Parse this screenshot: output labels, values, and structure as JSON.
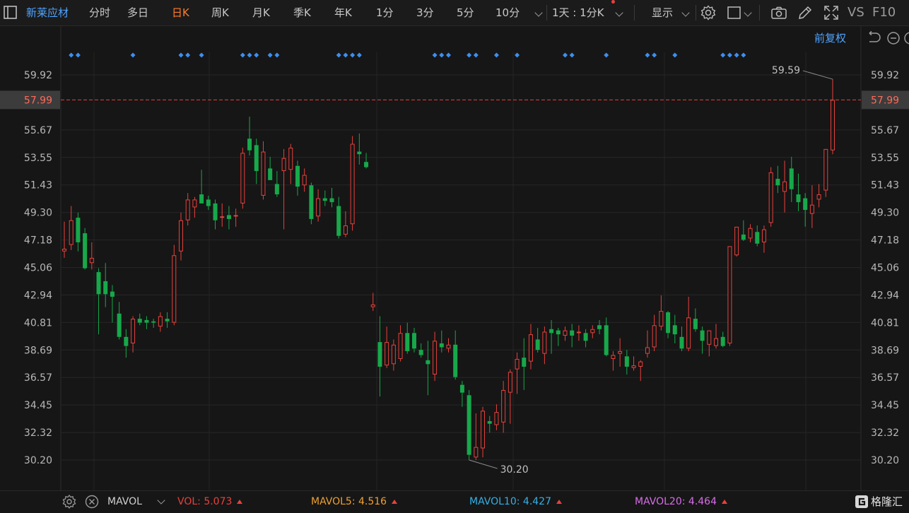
{
  "toolbar": {
    "stock_name": "新莱应材",
    "periods": [
      "分时",
      "多日",
      "日K",
      "周K",
      "月K",
      "季K",
      "年K",
      "1分",
      "3分",
      "5分",
      "10分"
    ],
    "active_period": "日K",
    "multi_period": "1天 : 1分K",
    "display_label": "显示",
    "vs_label": "VS",
    "f10_label": "F10"
  },
  "adjust_label": "前复权",
  "chart_data": {
    "type": "candlestick",
    "y_ticks": [
      "59.92",
      "57.99",
      "55.67",
      "53.55",
      "51.43",
      "49.30",
      "47.18",
      "45.06",
      "42.94",
      "40.81",
      "38.69",
      "36.57",
      "34.45",
      "32.32",
      "30.20"
    ],
    "ylim": [
      30.2,
      59.92
    ],
    "current_price": "57.99",
    "max_label": "59.59",
    "min_label": "30.20",
    "colors": {
      "up": "#e8413c",
      "down": "#17a84a",
      "price_line": "#e8413c",
      "marker": "#3d8ff0"
    },
    "event_markers": [
      1,
      2,
      10,
      17,
      18,
      20,
      26,
      27,
      28,
      30,
      31,
      40,
      41,
      42,
      43,
      54,
      55,
      56,
      59,
      60,
      63,
      66,
      73,
      74,
      79,
      85,
      86,
      89,
      96,
      97,
      98,
      99
    ],
    "candles": [
      {
        "o": 46.3,
        "h": 48.6,
        "l": 45.8,
        "c": 46.5
      },
      {
        "o": 46.8,
        "h": 49.8,
        "l": 46.4,
        "c": 48.7
      },
      {
        "o": 48.9,
        "h": 49.3,
        "l": 46.3,
        "c": 47.0
      },
      {
        "o": 47.7,
        "h": 48.1,
        "l": 44.9,
        "c": 45.0
      },
      {
        "o": 45.4,
        "h": 47.0,
        "l": 44.9,
        "c": 45.8
      },
      {
        "o": 44.7,
        "h": 45.0,
        "l": 39.9,
        "c": 43.0
      },
      {
        "o": 44.0,
        "h": 45.4,
        "l": 42.0,
        "c": 43.0
      },
      {
        "o": 43.2,
        "h": 43.7,
        "l": 40.8,
        "c": 42.8
      },
      {
        "o": 41.5,
        "h": 42.4,
        "l": 39.5,
        "c": 39.7
      },
      {
        "o": 39.7,
        "h": 40.3,
        "l": 38.1,
        "c": 39.0
      },
      {
        "o": 39.2,
        "h": 41.3,
        "l": 38.5,
        "c": 41.1
      },
      {
        "o": 41.1,
        "h": 41.5,
        "l": 40.6,
        "c": 40.8
      },
      {
        "o": 41.0,
        "h": 41.3,
        "l": 40.3,
        "c": 40.8
      },
      {
        "o": 40.9,
        "h": 41.1,
        "l": 40.4,
        "c": 40.8
      },
      {
        "o": 40.5,
        "h": 41.6,
        "l": 40.1,
        "c": 41.3
      },
      {
        "o": 41.1,
        "h": 41.6,
        "l": 40.4,
        "c": 40.9
      },
      {
        "o": 40.8,
        "h": 46.8,
        "l": 40.6,
        "c": 46.0
      },
      {
        "o": 46.3,
        "h": 49.3,
        "l": 45.6,
        "c": 48.7
      },
      {
        "o": 48.7,
        "h": 50.8,
        "l": 48.3,
        "c": 50.3
      },
      {
        "o": 49.7,
        "h": 50.5,
        "l": 48.9,
        "c": 50.3
      },
      {
        "o": 50.7,
        "h": 52.6,
        "l": 50.4,
        "c": 50.0
      },
      {
        "o": 50.3,
        "h": 50.6,
        "l": 49.5,
        "c": 49.8
      },
      {
        "o": 50.0,
        "h": 50.3,
        "l": 48.0,
        "c": 48.7
      },
      {
        "o": 49.0,
        "h": 50.0,
        "l": 48.2,
        "c": 49.0
      },
      {
        "o": 49.1,
        "h": 49.8,
        "l": 48.0,
        "c": 48.8
      },
      {
        "o": 49.1,
        "h": 49.6,
        "l": 48.2,
        "c": 49.1
      },
      {
        "o": 50.0,
        "h": 54.3,
        "l": 49.6,
        "c": 53.9
      },
      {
        "o": 55.0,
        "h": 56.7,
        "l": 53.7,
        "c": 54.1
      },
      {
        "o": 54.5,
        "h": 55.0,
        "l": 51.5,
        "c": 52.5
      },
      {
        "o": 50.6,
        "h": 54.8,
        "l": 50.3,
        "c": 54.0
      },
      {
        "o": 52.7,
        "h": 53.6,
        "l": 51.8,
        "c": 51.8
      },
      {
        "o": 51.5,
        "h": 52.5,
        "l": 50.5,
        "c": 50.7
      },
      {
        "o": 52.5,
        "h": 54.2,
        "l": 48.0,
        "c": 53.5
      },
      {
        "o": 52.6,
        "h": 54.6,
        "l": 51.5,
        "c": 54.3
      },
      {
        "o": 52.9,
        "h": 53.3,
        "l": 50.6,
        "c": 51.3
      },
      {
        "o": 51.4,
        "h": 52.7,
        "l": 50.9,
        "c": 52.2
      },
      {
        "o": 51.4,
        "h": 51.6,
        "l": 48.4,
        "c": 48.8
      },
      {
        "o": 49.0,
        "h": 51.1,
        "l": 48.6,
        "c": 50.4
      },
      {
        "o": 50.4,
        "h": 51.0,
        "l": 49.8,
        "c": 50.2
      },
      {
        "o": 50.4,
        "h": 51.2,
        "l": 49.7,
        "c": 50.1
      },
      {
        "o": 49.8,
        "h": 50.5,
        "l": 47.3,
        "c": 47.5
      },
      {
        "o": 47.6,
        "h": 49.4,
        "l": 47.4,
        "c": 48.3
      },
      {
        "o": 48.4,
        "h": 55.2,
        "l": 47.9,
        "c": 54.6
      },
      {
        "o": 54.0,
        "h": 55.4,
        "l": 53.0,
        "c": 53.8
      },
      {
        "o": 53.2,
        "h": 53.9,
        "l": 52.7,
        "c": 52.8
      },
      {
        "o": 42.0,
        "h": 43.1,
        "l": 41.7,
        "c": 42.2
      },
      {
        "o": 39.3,
        "h": 41.3,
        "l": 35.1,
        "c": 37.4
      },
      {
        "o": 37.5,
        "h": 40.5,
        "l": 37.3,
        "c": 39.3
      },
      {
        "o": 37.6,
        "h": 39.5,
        "l": 37.1,
        "c": 39.1
      },
      {
        "o": 38.0,
        "h": 40.6,
        "l": 37.8,
        "c": 40.0
      },
      {
        "o": 40.0,
        "h": 40.8,
        "l": 38.4,
        "c": 38.6
      },
      {
        "o": 40.0,
        "h": 40.4,
        "l": 38.5,
        "c": 38.8
      },
      {
        "o": 38.7,
        "h": 39.2,
        "l": 38.1,
        "c": 38.3
      },
      {
        "o": 37.9,
        "h": 39.4,
        "l": 35.2,
        "c": 37.6
      },
      {
        "o": 36.8,
        "h": 40.1,
        "l": 36.3,
        "c": 39.4
      },
      {
        "o": 39.2,
        "h": 40.2,
        "l": 38.5,
        "c": 38.9
      },
      {
        "o": 38.8,
        "h": 39.6,
        "l": 38.5,
        "c": 39.1
      },
      {
        "o": 39.1,
        "h": 40.2,
        "l": 36.4,
        "c": 36.6
      },
      {
        "o": 36.0,
        "h": 36.3,
        "l": 34.3,
        "c": 35.4
      },
      {
        "o": 35.2,
        "h": 35.6,
        "l": 30.2,
        "c": 30.6
      },
      {
        "o": 30.4,
        "h": 33.8,
        "l": 30.2,
        "c": 31.2
      },
      {
        "o": 31.1,
        "h": 34.3,
        "l": 30.4,
        "c": 34.0
      },
      {
        "o": 33.2,
        "h": 33.6,
        "l": 32.3,
        "c": 33.0
      },
      {
        "o": 32.9,
        "h": 34.5,
        "l": 32.5,
        "c": 33.9
      },
      {
        "o": 33.1,
        "h": 36.3,
        "l": 32.3,
        "c": 35.6
      },
      {
        "o": 35.4,
        "h": 37.2,
        "l": 33.0,
        "c": 37.0
      },
      {
        "o": 37.2,
        "h": 38.5,
        "l": 35.3,
        "c": 38.0
      },
      {
        "o": 38.1,
        "h": 39.6,
        "l": 35.6,
        "c": 37.4
      },
      {
        "o": 37.8,
        "h": 40.7,
        "l": 37.2,
        "c": 39.9
      },
      {
        "o": 39.5,
        "h": 40.4,
        "l": 38.5,
        "c": 38.7
      },
      {
        "o": 38.4,
        "h": 40.5,
        "l": 37.6,
        "c": 40.1
      },
      {
        "o": 40.3,
        "h": 41.0,
        "l": 38.4,
        "c": 40.0
      },
      {
        "o": 40.2,
        "h": 40.4,
        "l": 39.0,
        "c": 39.9
      },
      {
        "o": 39.8,
        "h": 40.5,
        "l": 39.4,
        "c": 40.2
      },
      {
        "o": 40.2,
        "h": 40.7,
        "l": 38.9,
        "c": 39.8
      },
      {
        "o": 40.1,
        "h": 40.6,
        "l": 39.4,
        "c": 40.1
      },
      {
        "o": 40.0,
        "h": 40.3,
        "l": 38.9,
        "c": 39.4
      },
      {
        "o": 40.0,
        "h": 40.6,
        "l": 39.6,
        "c": 40.3
      },
      {
        "o": 40.6,
        "h": 41.0,
        "l": 39.9,
        "c": 40.3
      },
      {
        "o": 40.6,
        "h": 41.2,
        "l": 38.2,
        "c": 38.3
      },
      {
        "o": 38.0,
        "h": 38.6,
        "l": 37.1,
        "c": 38.3
      },
      {
        "o": 38.4,
        "h": 39.6,
        "l": 37.4,
        "c": 38.6
      },
      {
        "o": 38.2,
        "h": 38.7,
        "l": 36.8,
        "c": 37.4
      },
      {
        "o": 37.3,
        "h": 38.2,
        "l": 37.1,
        "c": 37.5
      },
      {
        "o": 37.4,
        "h": 37.9,
        "l": 36.3,
        "c": 37.8
      },
      {
        "o": 38.4,
        "h": 40.2,
        "l": 38.1,
        "c": 38.9
      },
      {
        "o": 38.9,
        "h": 41.4,
        "l": 38.6,
        "c": 40.6
      },
      {
        "o": 40.5,
        "h": 42.9,
        "l": 40.2,
        "c": 41.7
      },
      {
        "o": 41.6,
        "h": 41.7,
        "l": 39.6,
        "c": 40.0
      },
      {
        "o": 40.6,
        "h": 41.4,
        "l": 39.2,
        "c": 39.9
      },
      {
        "o": 39.7,
        "h": 40.5,
        "l": 38.6,
        "c": 38.8
      },
      {
        "o": 38.8,
        "h": 42.8,
        "l": 38.6,
        "c": 41.2
      },
      {
        "o": 41.1,
        "h": 41.9,
        "l": 40.1,
        "c": 40.3
      },
      {
        "o": 40.2,
        "h": 40.5,
        "l": 38.4,
        "c": 39.4
      },
      {
        "o": 39.1,
        "h": 40.2,
        "l": 38.2,
        "c": 40.2
      },
      {
        "o": 39.0,
        "h": 40.7,
        "l": 38.8,
        "c": 39.6
      },
      {
        "o": 39.7,
        "h": 40.1,
        "l": 38.9,
        "c": 39.0
      },
      {
        "o": 39.2,
        "h": 46.5,
        "l": 39.0,
        "c": 46.7
      },
      {
        "o": 46.0,
        "h": 48.2,
        "l": 45.9,
        "c": 48.2
      },
      {
        "o": 47.6,
        "h": 48.7,
        "l": 47.1,
        "c": 47.2
      },
      {
        "o": 47.3,
        "h": 48.4,
        "l": 47.0,
        "c": 48.1
      },
      {
        "o": 47.8,
        "h": 48.3,
        "l": 46.7,
        "c": 46.9
      },
      {
        "o": 47.0,
        "h": 48.3,
        "l": 46.2,
        "c": 48.0
      },
      {
        "o": 48.5,
        "h": 52.8,
        "l": 48.2,
        "c": 52.4
      },
      {
        "o": 51.9,
        "h": 52.9,
        "l": 50.8,
        "c": 51.4
      },
      {
        "o": 50.9,
        "h": 53.3,
        "l": 49.3,
        "c": 51.7
      },
      {
        "o": 52.7,
        "h": 53.6,
        "l": 50.1,
        "c": 51.1
      },
      {
        "o": 50.7,
        "h": 52.3,
        "l": 49.4,
        "c": 50.1
      },
      {
        "o": 50.4,
        "h": 50.8,
        "l": 48.2,
        "c": 49.5
      },
      {
        "o": 49.2,
        "h": 51.4,
        "l": 48.1,
        "c": 49.9
      },
      {
        "o": 50.3,
        "h": 51.5,
        "l": 49.7,
        "c": 50.7
      },
      {
        "o": 51.0,
        "h": 54.2,
        "l": 50.5,
        "c": 54.2
      },
      {
        "o": 54.1,
        "h": 59.59,
        "l": 53.8,
        "c": 57.99
      }
    ]
  },
  "bottom": {
    "indicator": "MAVOL",
    "vol_label": "VOL:",
    "vol_value": "5.073",
    "mavol5_label": "MAVOL5:",
    "mavol5_value": "4.516",
    "mavol10_label": "MAVOL10:",
    "mavol10_value": "4.427",
    "mavol20_label": "MAVOL20:",
    "mavol20_value": "4.464",
    "brand": "格隆汇",
    "colors": {
      "vol": "#e8413c",
      "mavol5": "#f0a030",
      "mavol10": "#33b0e8",
      "mavol20": "#d76de8"
    }
  }
}
